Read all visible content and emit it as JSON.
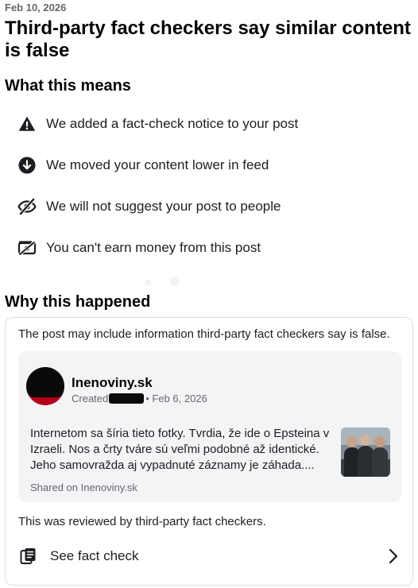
{
  "header": {
    "date": "Feb 10, 2026",
    "title": "Third-party fact checkers say similar content is false"
  },
  "what_this_means": {
    "heading": "What this means",
    "items": [
      {
        "icon": "warning-icon",
        "text": "We added a fact-check notice to your post"
      },
      {
        "icon": "arrow-down-circle-icon",
        "text": "We moved your content lower in feed"
      },
      {
        "icon": "eye-off-icon",
        "text": "We will not suggest your post to people"
      },
      {
        "icon": "money-off-icon",
        "text": "You can't earn money from this post"
      }
    ]
  },
  "why_this_happened": {
    "heading": "Why this happened",
    "intro": "The post may include information third-party fact checkers say is false.",
    "post": {
      "page_name": "Inenoviny.sk",
      "created_prefix": "Created",
      "date": "• Feb 6, 2026",
      "text": "Internetom sa šíria tieto fotky. Tvrdia, že ide o Epsteina v Izraeli. Nos a črty tváre sú veľmi podobné až identické. Jeho samovražda aj vypadnuté záznamy je záhada....",
      "shared_on": "Shared on Inenoviny.sk"
    },
    "reviewed": "This was reviewed by third-party fact checkers.",
    "see_fact_check": "See fact check"
  },
  "colors": {
    "text_primary": "#050505",
    "text_secondary": "#65676b",
    "post_bg": "#f3f4f6",
    "card_border": "#dadde1",
    "avatar_red": "#b3001b"
  }
}
